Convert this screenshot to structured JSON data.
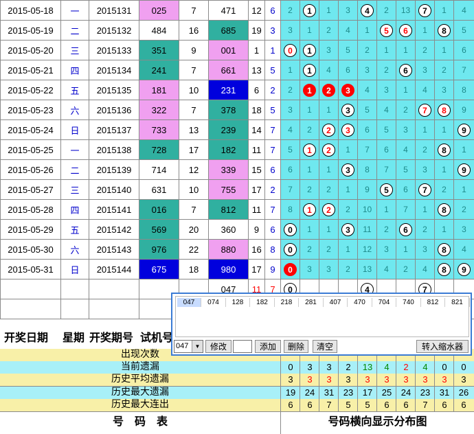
{
  "rows": [
    {
      "date": "2015-05-18",
      "wd": "一",
      "issue": "2015131",
      "tn": "025",
      "sum": "7",
      "win": "471",
      "s2": "12",
      "s3": "6",
      "d": [
        "2",
        "1",
        "1",
        "3",
        "4",
        "2",
        "13",
        "7",
        "1",
        "4"
      ],
      "balls": [
        1,
        4,
        7
      ]
    },
    {
      "date": "2015-05-19",
      "wd": "二",
      "issue": "2015132",
      "tn": "484",
      "sum": "16",
      "win": "685",
      "s2": "19",
      "s3": "3",
      "d": [
        "3",
        "1",
        "2",
        "4",
        "1",
        "5",
        "6",
        "1",
        "8",
        "5"
      ],
      "balls": [
        5,
        6,
        8
      ]
    },
    {
      "date": "2015-05-20",
      "wd": "三",
      "issue": "2015133",
      "tn": "351",
      "sum": "9",
      "win": "001",
      "s2": "1",
      "s3": "1",
      "d": [
        "0",
        "1",
        "3",
        "5",
        "2",
        "1",
        "1",
        "2",
        "1",
        "6"
      ],
      "balls": [
        0,
        1
      ]
    },
    {
      "date": "2015-05-21",
      "wd": "四",
      "issue": "2015134",
      "tn": "241",
      "sum": "7",
      "win": "661",
      "s2": "13",
      "s3": "5",
      "d": [
        "1",
        "1",
        "4",
        "6",
        "3",
        "2",
        "6",
        "3",
        "2",
        "7"
      ],
      "balls": [
        1,
        6
      ]
    },
    {
      "date": "2015-05-22",
      "wd": "五",
      "issue": "2015135",
      "tn": "181",
      "sum": "10",
      "win": "231",
      "s2": "6",
      "s3": "2",
      "d": [
        "2",
        "1",
        "2",
        "3",
        "4",
        "3",
        "1",
        "4",
        "3",
        "8"
      ],
      "balls": [
        1,
        2,
        3
      ]
    },
    {
      "date": "2015-05-23",
      "wd": "六",
      "issue": "2015136",
      "tn": "322",
      "sum": "7",
      "win": "378",
      "s2": "18",
      "s3": "5",
      "d": [
        "3",
        "1",
        "1",
        "3",
        "5",
        "4",
        "2",
        "7",
        "8",
        "9"
      ],
      "balls": [
        3,
        7,
        8
      ]
    },
    {
      "date": "2015-05-24",
      "wd": "日",
      "issue": "2015137",
      "tn": "733",
      "sum": "13",
      "win": "239",
      "s2": "14",
      "s3": "7",
      "d": [
        "4",
        "2",
        "2",
        "3",
        "6",
        "5",
        "3",
        "1",
        "1",
        "9"
      ],
      "balls": [
        2,
        3,
        9
      ]
    },
    {
      "date": "2015-05-25",
      "wd": "一",
      "issue": "2015138",
      "tn": "728",
      "sum": "17",
      "win": "182",
      "s2": "11",
      "s3": "7",
      "d": [
        "5",
        "1",
        "2",
        "1",
        "7",
        "6",
        "4",
        "2",
        "8",
        "1"
      ],
      "balls": [
        1,
        2,
        8
      ]
    },
    {
      "date": "2015-05-26",
      "wd": "二",
      "issue": "2015139",
      "tn": "714",
      "sum": "12",
      "win": "339",
      "s2": "15",
      "s3": "6",
      "d": [
        "6",
        "1",
        "1",
        "3",
        "8",
        "7",
        "5",
        "3",
        "1",
        "9"
      ],
      "balls": [
        3,
        9
      ]
    },
    {
      "date": "2015-05-27",
      "wd": "三",
      "issue": "2015140",
      "tn": "631",
      "sum": "10",
      "win": "755",
      "s2": "17",
      "s3": "2",
      "d": [
        "7",
        "2",
        "2",
        "1",
        "9",
        "5",
        "6",
        "7",
        "2",
        "1"
      ],
      "balls": [
        5,
        7
      ]
    },
    {
      "date": "2015-05-28",
      "wd": "四",
      "issue": "2015141",
      "tn": "016",
      "sum": "7",
      "win": "812",
      "s2": "11",
      "s3": "7",
      "d": [
        "8",
        "1",
        "2",
        "2",
        "10",
        "1",
        "7",
        "1",
        "8",
        "2"
      ],
      "balls": [
        1,
        2,
        8
      ]
    },
    {
      "date": "2015-05-29",
      "wd": "五",
      "issue": "2015142",
      "tn": "569",
      "sum": "20",
      "win": "360",
      "s2": "9",
      "s3": "6",
      "d": [
        "0",
        "1",
        "1",
        "3",
        "11",
        "2",
        "6",
        "2",
        "1",
        "3"
      ],
      "balls": [
        0,
        3,
        6
      ]
    },
    {
      "date": "2015-05-30",
      "wd": "六",
      "issue": "2015143",
      "tn": "976",
      "sum": "22",
      "win": "880",
      "s2": "16",
      "s3": "8",
      "d": [
        "0",
        "2",
        "2",
        "1",
        "12",
        "3",
        "1",
        "3",
        "8",
        "4"
      ],
      "balls": [
        0,
        8
      ]
    },
    {
      "date": "2015-05-31",
      "wd": "日",
      "issue": "2015144",
      "tn": "675",
      "sum": "18",
      "win": "980",
      "s2": "17",
      "s3": "9",
      "d": [
        "0",
        "3",
        "3",
        "2",
        "13",
        "4",
        "2",
        "4",
        "8",
        "9"
      ],
      "balls": [
        0,
        8,
        9
      ]
    }
  ],
  "trial_row": {
    "win": "047",
    "s2": "11",
    "s3": "7",
    "balls": [
      "0",
      "4",
      "7"
    ]
  },
  "dialog": {
    "chips": [
      "047",
      "074",
      "128",
      "182",
      "218",
      "281",
      "407",
      "470",
      "704",
      "740",
      "812",
      "821"
    ],
    "select_value": "047",
    "btn_modify": "修改",
    "btn_add": "添加",
    "btn_delete": "删除",
    "btn_clear": "清空",
    "btn_transfer": "转入缩水器"
  },
  "header": {
    "date": "开奖日期",
    "weekday": "星期",
    "issue": "开奖期号",
    "trial": "试机号"
  },
  "stats": [
    {
      "label": "出现次数",
      "values": [
        "",
        "",
        "",
        "",
        "",
        "",
        "",
        "",
        "",
        ""
      ]
    },
    {
      "label": "当前遗漏",
      "values": [
        "0",
        "3",
        "3",
        "2",
        "13",
        "4",
        "2",
        "4",
        "0",
        "0"
      ]
    },
    {
      "label": "历史平均遗漏",
      "values": [
        "3",
        "3",
        "3",
        "3",
        "3",
        "3",
        "3",
        "3",
        "3",
        "3"
      ]
    },
    {
      "label": "历史最大遗漏",
      "values": [
        "19",
        "24",
        "31",
        "23",
        "17",
        "25",
        "24",
        "23",
        "31",
        "26"
      ]
    },
    {
      "label": "历史最大连出",
      "values": [
        "6",
        "6",
        "7",
        "5",
        "5",
        "6",
        "6",
        "7",
        "6",
        "6"
      ]
    }
  ],
  "footer": {
    "left": "号　码　表",
    "right": "号码横向显示分布图"
  }
}
